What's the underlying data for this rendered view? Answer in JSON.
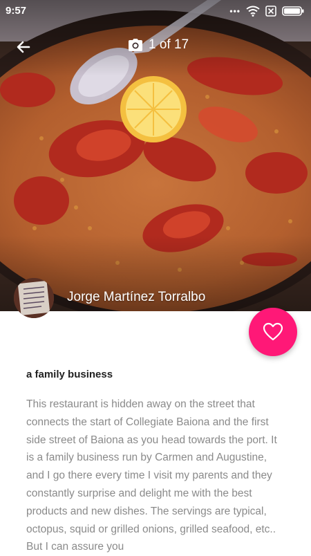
{
  "status_bar": {
    "time": "9:57"
  },
  "header": {
    "photo_count": "1 of 17"
  },
  "author": {
    "name": "Jorge Martínez Torralbo"
  },
  "review": {
    "title": "a family business",
    "body": "This restaurant is hidden away on the street that connects the start of Collegiate Baiona and the first side street of Baiona as you head towards the port. It is a family business run by Carmen and Augustine, and I go there every time I visit my parents and they constantly surprise and delight me with the best products and new dishes. The servings are typical, octopus, squid or grilled onions, grilled seafood, etc.. But I can assure you"
  },
  "colors": {
    "accent": "#ff1877",
    "body_text": "#8a8a8a",
    "title_text": "#222222"
  },
  "icons": {
    "back": "arrow-left-icon",
    "camera": "camera-icon",
    "favorite": "heart-outline-icon",
    "wifi": "wifi-icon",
    "sim": "no-sim-icon",
    "battery": "battery-icon"
  }
}
